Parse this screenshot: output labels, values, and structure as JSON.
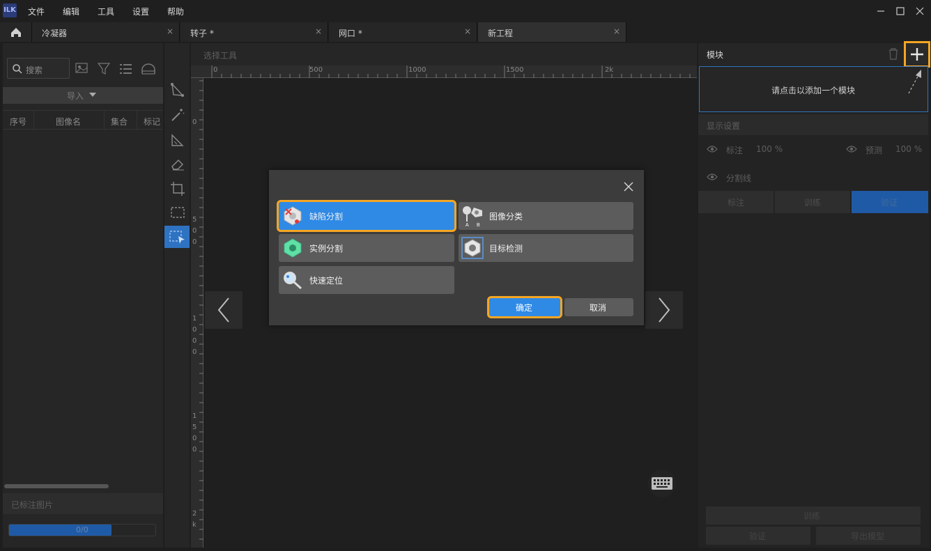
{
  "menu": {
    "logo": "ILK",
    "file": "文件",
    "edit": "编辑",
    "tools": "工具",
    "settings": "设置",
    "help": "帮助"
  },
  "tabs": [
    {
      "label": "冷凝器",
      "close": "×"
    },
    {
      "label": "转子 *",
      "close": "×"
    },
    {
      "label": "网口 *",
      "close": "×"
    },
    {
      "label": "新工程",
      "close": "×"
    }
  ],
  "left": {
    "search_placeholder": "搜索",
    "import": "导入",
    "columns": [
      "序号",
      "图像名",
      "集合",
      "标记"
    ],
    "labeled_title": "已标注图片",
    "progress_text": "0/0",
    "progress_fraction": 0.7
  },
  "canvas": {
    "select_tool": "选择工具",
    "ruler_top": [
      "0",
      "500",
      "1000",
      "1500",
      "2k"
    ],
    "ruler_left": [
      "0",
      "5",
      "0",
      "0",
      "1",
      "0",
      "0",
      "0",
      "1",
      "5",
      "0",
      "0",
      "2",
      "k"
    ]
  },
  "right": {
    "module_title": "模块",
    "add_module_hint": "请点击以添加一个模块",
    "display_settings": "显示设置",
    "annotation": "标注",
    "annotation_pct": "100 %",
    "prediction": "预测",
    "prediction_pct": "100 %",
    "seg_line": "分割线",
    "tabs": [
      "标注",
      "训练",
      "验证"
    ],
    "train_btn": "训练",
    "verify_btn": "验证",
    "export_btn": "导出模型"
  },
  "dialog": {
    "close": "×",
    "options": [
      "缺陷分割",
      "图像分类",
      "实例分割",
      "目标检测",
      "快速定位"
    ],
    "ok": "确定",
    "cancel": "取消"
  }
}
